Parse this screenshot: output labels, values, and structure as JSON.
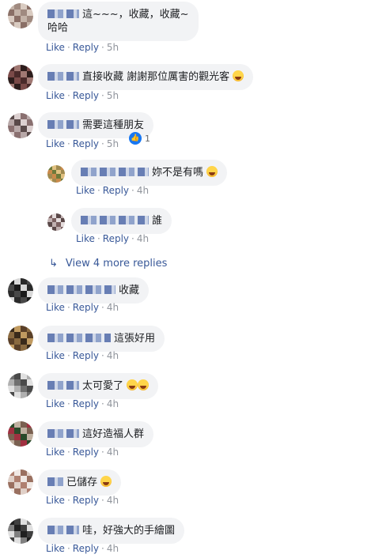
{
  "actions": {
    "like": "Like",
    "reply": "Reply",
    "separator": "·"
  },
  "view_more": {
    "arrow": "↳",
    "label": "View 4 more replies"
  },
  "comments": [
    {
      "text": "這~~~，收藏，收藏~",
      "text2": "哈哈",
      "time": "5h",
      "colors": [
        "#c4b3a8",
        "#8a6f66",
        "#d9cbc1",
        "#a08a80"
      ]
    },
    {
      "text": "直接收藏 謝謝那位厲害的觀光客",
      "time": "5h",
      "colors": [
        "#4a2a2a",
        "#7a4a48",
        "#2d1d1c",
        "#a07873"
      ]
    },
    {
      "text": "需要這種朋友",
      "time": "5h",
      "reaction_count": "1",
      "colors": [
        "#5a4a4a",
        "#b8a8a8",
        "#8a7070",
        "#dcd0d0"
      ]
    },
    {
      "text": "妳不是有嗎",
      "time": "4h",
      "colors": [
        "#6d7a3a",
        "#c98a4a",
        "#a08a50",
        "#e0c080"
      ]
    },
    {
      "text": "誰",
      "time": "4h",
      "colors": [
        "#7a6060",
        "#c0b0b0",
        "#5a4848",
        "#e4dcdc"
      ]
    },
    {
      "text": "收藏",
      "time": "4h",
      "colors": [
        "#1a1a1a",
        "#484848",
        "#2a2a2a",
        "#d8d8d8"
      ]
    },
    {
      "text": "這張好用",
      "time": "4h",
      "colors": [
        "#3a2a1a",
        "#8a6a40",
        "#5a4028",
        "#c09a60"
      ]
    },
    {
      "text": "太可愛了",
      "time": "4h",
      "colors": [
        "#707070",
        "#b0b0b0",
        "#e0e0e0",
        "#4a4a4a"
      ]
    },
    {
      "text": "這好造福人群",
      "time": "4h",
      "colors": [
        "#2a4a2a",
        "#a03040",
        "#7a6050",
        "#c0b0a0"
      ]
    },
    {
      "text": "已儲存",
      "time": "4h",
      "colors": [
        "#b08070",
        "#e0d0c8",
        "#9a7060",
        "#f0e8e4"
      ]
    },
    {
      "text": "哇，好強大的手繪圖",
      "time": "4h",
      "colors": [
        "#202020",
        "#808080",
        "#e0e0e0",
        "#404040"
      ]
    }
  ]
}
